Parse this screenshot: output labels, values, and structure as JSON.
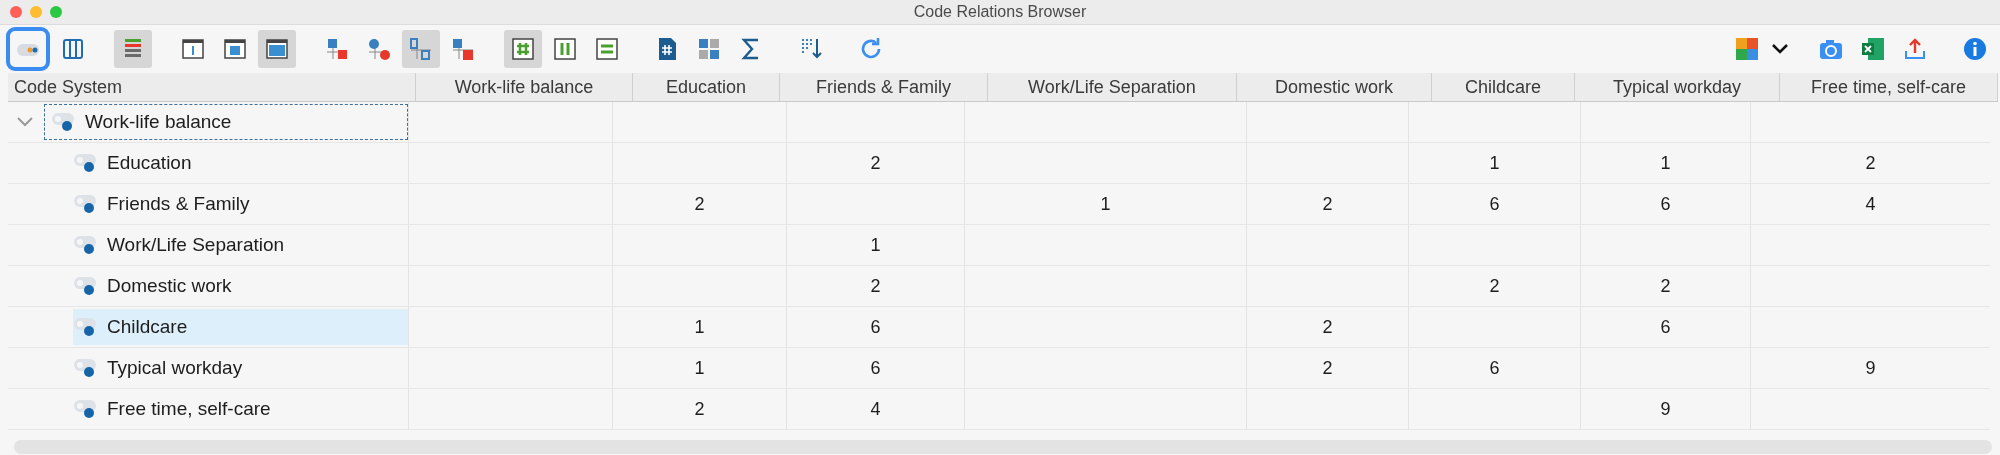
{
  "window": {
    "title": "Code Relations Browser"
  },
  "toolbar": {
    "left": [
      {
        "kind": "code-toggle",
        "pressed": false,
        "focused": true
      },
      {
        "kind": "columns",
        "pressed": false,
        "focused": false
      },
      {
        "kind": "bars",
        "pressed": true,
        "focused": false
      },
      {
        "kind": "frame-bar",
        "pressed": false,
        "focused": false
      },
      {
        "kind": "frame-small",
        "pressed": false,
        "focused": false
      },
      {
        "kind": "frame-full",
        "pressed": true,
        "focused": false
      },
      {
        "kind": "square-node",
        "pressed": false,
        "focused": false
      },
      {
        "kind": "circle-node",
        "pressed": false,
        "focused": false
      },
      {
        "kind": "number-grid",
        "pressed": true,
        "focused": false
      },
      {
        "kind": "number-grid-red",
        "pressed": false,
        "focused": false
      },
      {
        "kind": "hash-grid",
        "pressed": true,
        "focused": false
      },
      {
        "kind": "bars-grid",
        "pressed": false,
        "focused": false
      },
      {
        "kind": "lines-grid",
        "pressed": false,
        "focused": false
      },
      {
        "kind": "hash-doc",
        "pressed": false,
        "focused": false
      },
      {
        "kind": "matrix",
        "pressed": false,
        "focused": false
      },
      {
        "kind": "sigma",
        "pressed": false,
        "focused": false
      },
      {
        "kind": "sort",
        "pressed": false,
        "focused": false
      },
      {
        "kind": "refresh",
        "pressed": false,
        "focused": false
      }
    ],
    "right": [
      {
        "kind": "puzzle",
        "pressed": false,
        "focused": false
      },
      {
        "kind": "caret",
        "pressed": false,
        "focused": false
      },
      {
        "kind": "camera",
        "pressed": false,
        "focused": false
      },
      {
        "kind": "excel",
        "pressed": false,
        "focused": false
      },
      {
        "kind": "upload",
        "pressed": false,
        "focused": false
      },
      {
        "kind": "info",
        "pressed": false,
        "focused": false
      }
    ]
  },
  "table": {
    "corner": "Code System",
    "columns": [
      "Work-life balance",
      "Education",
      "Friends & Family",
      "Work/Life Separation",
      "Domestic work",
      "Childcare",
      "Typical workday",
      "Free time, self-care"
    ],
    "rows": [
      {
        "label": "Work-life balance",
        "expanded": true,
        "focused": true,
        "selected": false,
        "cells": [
          null,
          null,
          null,
          null,
          null,
          null,
          null,
          null
        ],
        "children": [
          {
            "label": "Education",
            "selected": false,
            "cells": [
              null,
              null,
              "2",
              null,
              null,
              "1",
              "1",
              "2"
            ]
          },
          {
            "label": "Friends & Family",
            "selected": false,
            "cells": [
              null,
              "2",
              null,
              "1",
              "2",
              "6",
              "6",
              "4"
            ]
          },
          {
            "label": "Work/Life Separation",
            "selected": false,
            "cells": [
              null,
              null,
              "1",
              null,
              null,
              null,
              null,
              null
            ]
          },
          {
            "label": "Domestic work",
            "selected": false,
            "cells": [
              null,
              null,
              "2",
              null,
              null,
              "2",
              "2",
              null
            ]
          },
          {
            "label": "Childcare",
            "selected": true,
            "cells": [
              null,
              "1",
              "6",
              null,
              "2",
              null,
              "6",
              null
            ]
          },
          {
            "label": "Typical workday",
            "selected": false,
            "cells": [
              null,
              "1",
              "6",
              null,
              "2",
              "6",
              null,
              "9"
            ]
          },
          {
            "label": "Free time, self-care",
            "selected": false,
            "cells": [
              null,
              "2",
              "4",
              null,
              null,
              null,
              "9",
              null
            ]
          }
        ]
      }
    ]
  }
}
